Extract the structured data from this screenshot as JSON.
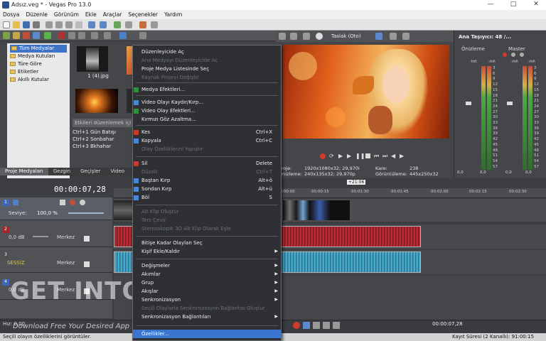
{
  "window": {
    "title": "Adsız.veg * - Vegas Pro 13.0"
  },
  "menu": [
    "Dosya",
    "Düzenle",
    "Görünüm",
    "Ekle",
    "Araçlar",
    "Seçenekler",
    "Yardım"
  ],
  "tree": {
    "items": [
      "Tüm Medyalar",
      "Medya Kutuları",
      "Türe Göre",
      "Etiketler",
      "Akıllı Kutular"
    ]
  },
  "media": {
    "thumb1_label": "1 (4).jpg",
    "effects_placeholder": "Etkileri düzenlemek içi",
    "effects": [
      "Ctrl+1 Gün Batışı",
      "Ctrl+2 Sonbahar",
      "Ctrl+3 Bkhahar"
    ]
  },
  "tabs": [
    "Proje Medyaları",
    "Gezgin",
    "Geçişler",
    "Video"
  ],
  "preview": {
    "quality": "Taslak (Oto)",
    "proje_label": "Proje:",
    "proje_value": "1920x1080x32; 29,970i",
    "kare_label": "Kare:",
    "kare_value": "238",
    "onizleme_label": "Önizleme:",
    "onizleme_value": "240x135x32; 29,970p",
    "goruntuleme_label": "Görüntüleme:",
    "goruntuleme_value": "445x250x32"
  },
  "mixer": {
    "title": "Ana Taşıyıcı: 48 /...",
    "onizleme": "Önizleme",
    "master": "Master",
    "top_inf": "-Inf.",
    "scale": [
      "3",
      "6",
      "9",
      "12",
      "15",
      "18",
      "21",
      "24",
      "27",
      "30",
      "33",
      "36",
      "39",
      "42",
      "45",
      "48",
      "51",
      "54",
      "57"
    ],
    "bottom_values": [
      "0,0",
      "0,0",
      "0,0",
      "0,0"
    ]
  },
  "timeline": {
    "timecode": "00:00:07,28",
    "cursor_time": "+21:06",
    "ruler": [
      "00:00:00",
      "00:00:15",
      "00:01:30",
      "00:01:45",
      "00:02:00",
      "00:02:15",
      "00:02:30"
    ],
    "track1": {
      "number": "1",
      "level_label": "Seviye:",
      "level_value": "100,0 %"
    },
    "track2": {
      "number": "2",
      "vol": "0,0 dB",
      "pan": "Merkez"
    },
    "track3": {
      "number": "3",
      "state": "SESSİZ",
      "pan": "Merkez"
    },
    "track4": {
      "number": "4",
      "vol": "0,0 dB",
      "pan": "Merkez"
    }
  },
  "bottom": {
    "hiz_label": "Hız: 0,00",
    "time1": "00:00:07,28",
    "rec_time": "Kayıt Süresi (2 Kanallı): 91:00:15"
  },
  "status": {
    "text": "Seçili olayın özelliklerini görüntüler."
  },
  "watermark": {
    "main": "GET INTO PC",
    "sub": "Download Free Your Desired App"
  },
  "context_menu": {
    "items": [
      {
        "label": "Düzenleyicide Aç",
        "enabled": true
      },
      {
        "label": "Ana Medyayı Düzenleyicide Aç",
        "enabled": false
      },
      {
        "label": "Proje Medya Listesinde Seç",
        "enabled": true
      },
      {
        "label": "Kaynak Projeyi Değiştir",
        "enabled": false
      },
      {
        "label": "Medya Efektleri...",
        "enabled": true
      },
      {
        "label": "Video Olayı Kaydır/Kırp...",
        "enabled": true
      },
      {
        "label": "Video Olay Efektleri...",
        "enabled": true
      },
      {
        "label": "Kırmızı Göz Azaltma...",
        "enabled": true
      },
      {
        "label": "Kes",
        "shortcut": "Ctrl+X",
        "enabled": true
      },
      {
        "label": "Kopyala",
        "shortcut": "Ctrl+C",
        "enabled": true
      },
      {
        "label": "Olay Özelliklerini Yapıştır",
        "enabled": false
      },
      {
        "label": "Sil",
        "shortcut": "Delete",
        "enabled": true
      },
      {
        "label": "Düzelt",
        "shortcut": "Ctrl+T",
        "enabled": false
      },
      {
        "label": "Baştan Kırp",
        "shortcut": "Alt+ö",
        "enabled": true
      },
      {
        "label": "Sondan Kırp",
        "shortcut": "Alt+ü",
        "enabled": true
      },
      {
        "label": "Böl",
        "shortcut": "S",
        "enabled": true
      },
      {
        "label": "Alt Klip Oluştur",
        "enabled": false
      },
      {
        "label": "Ters Çevir",
        "enabled": false
      },
      {
        "label": "Stereoskopik 3D Alt Klip Olarak Eşle",
        "enabled": false
      },
      {
        "label": "Bitişe Kadar Olaylan Seç",
        "enabled": true
      },
      {
        "label": "Kişif Ekle/Kaldır",
        "enabled": true
      },
      {
        "label": "Değişmeler",
        "enabled": true
      },
      {
        "label": "Akımlar",
        "enabled": true
      },
      {
        "label": "Grup",
        "enabled": true
      },
      {
        "label": "Akışlar",
        "enabled": true
      },
      {
        "label": "Senkronizasyon",
        "enabled": true
      },
      {
        "label": "Seçili Olaylarla Senkronizasyon Bağlantısı Oluştur",
        "enabled": false
      },
      {
        "label": "Senkronizasyon Bağlantıları",
        "enabled": true
      },
      {
        "label": "Özellikler...",
        "enabled": true
      }
    ]
  }
}
